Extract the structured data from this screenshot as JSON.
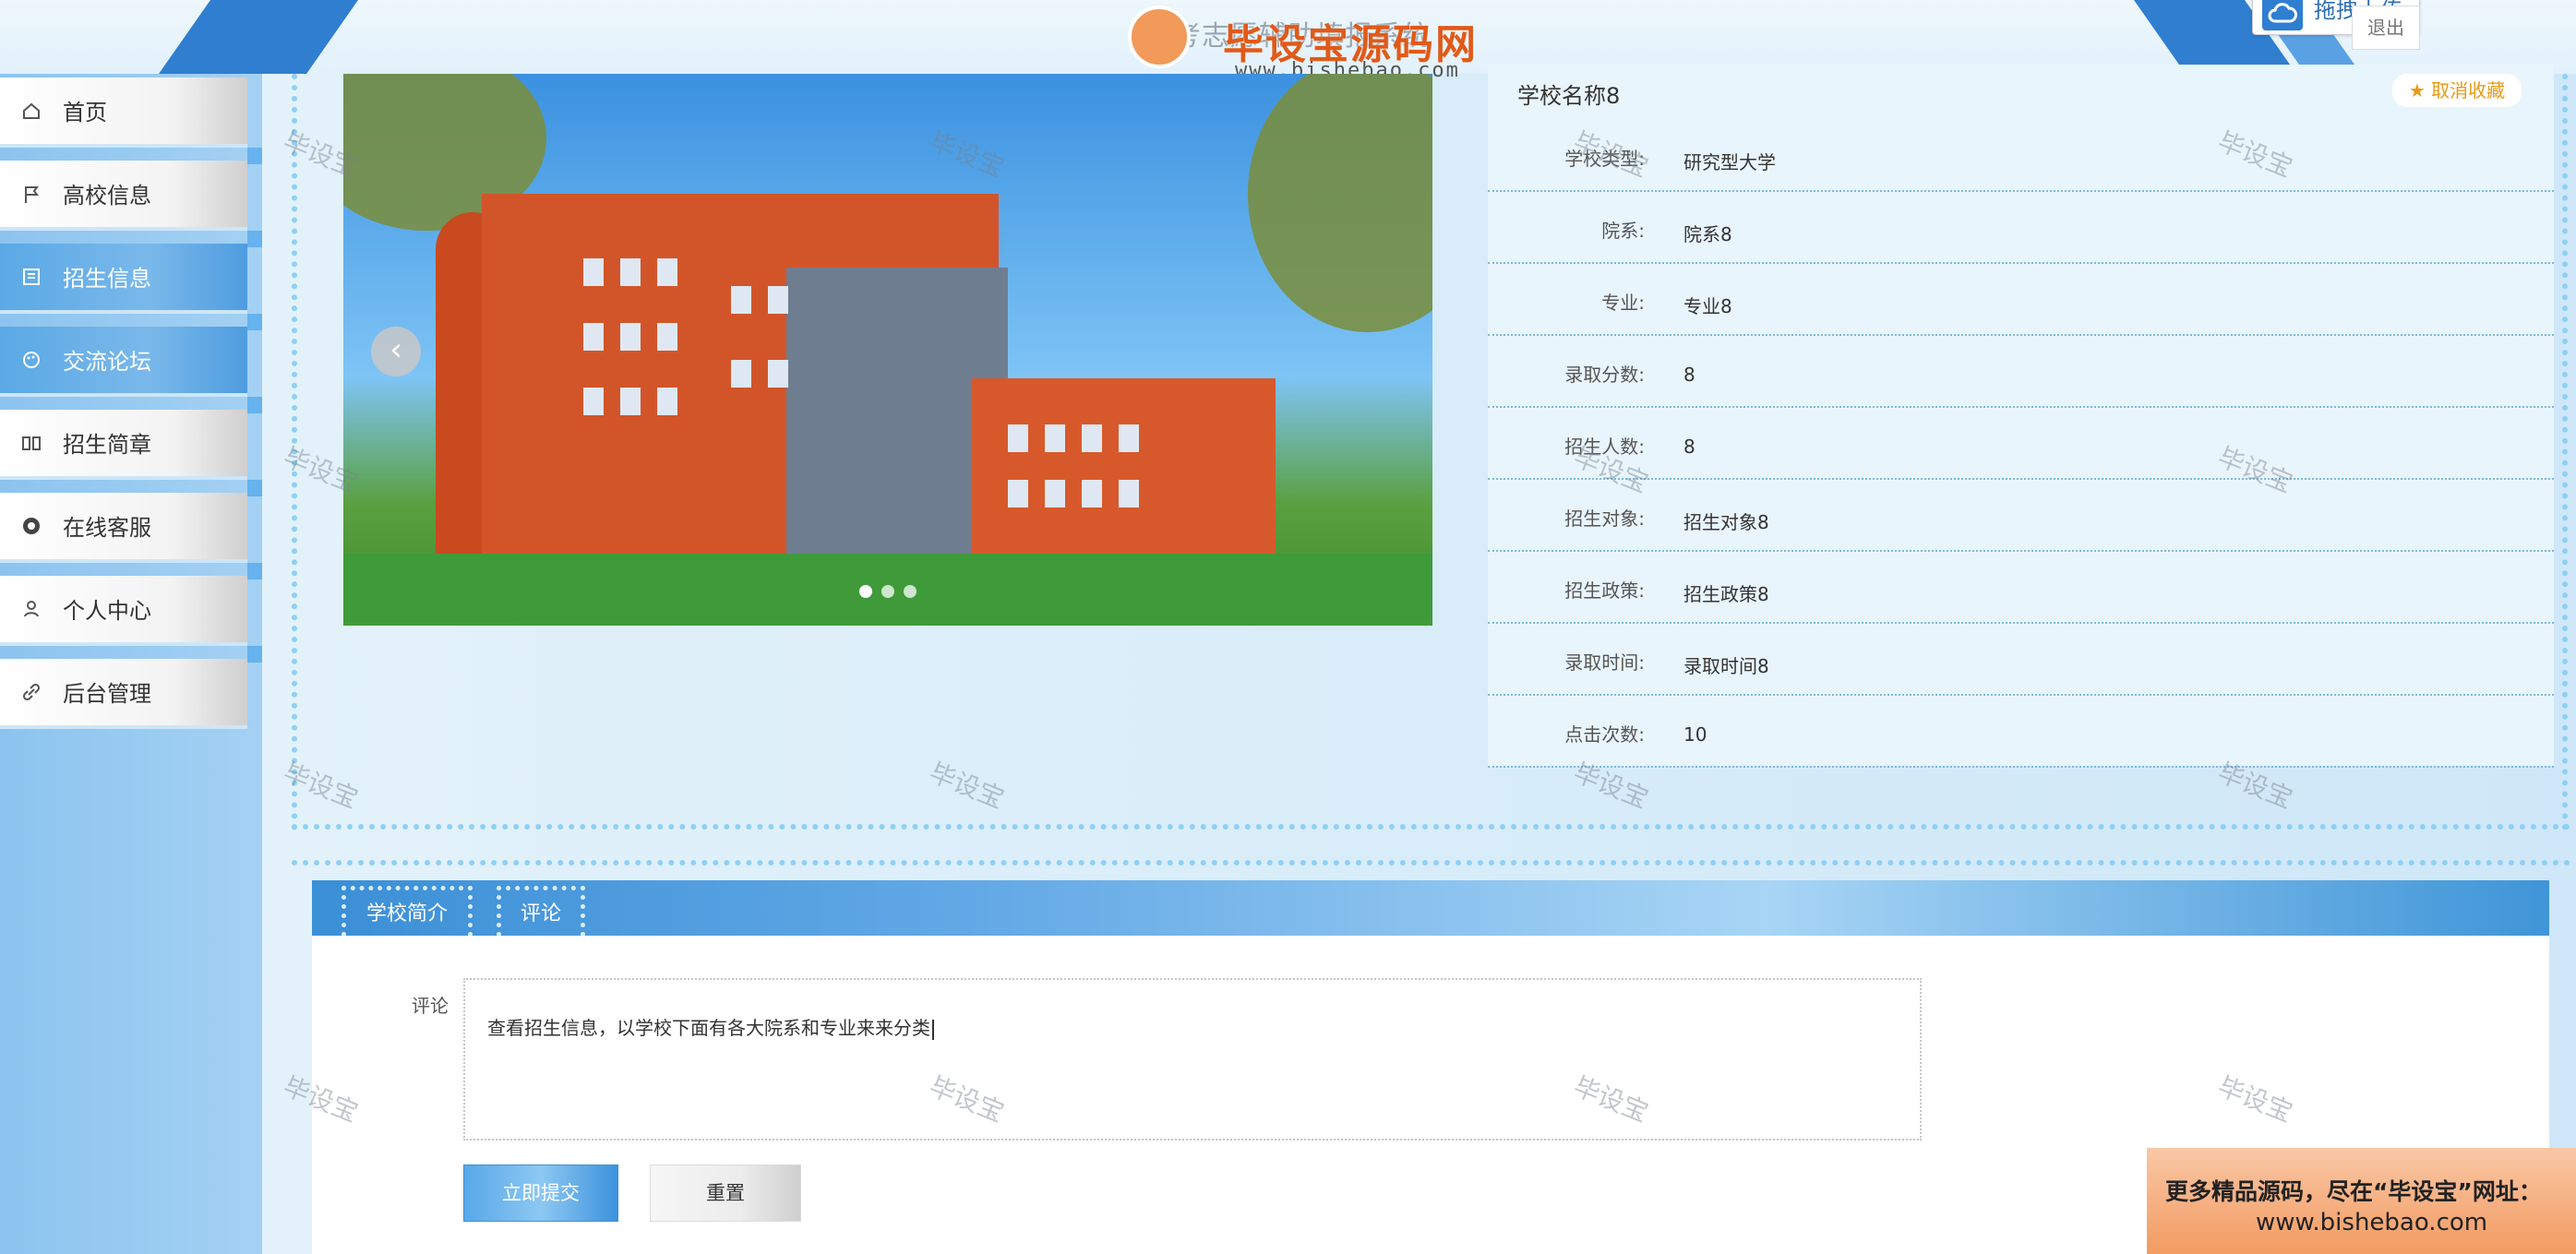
{
  "header": {
    "site_title": "高考志愿辅助填报系统",
    "upload_label": "拖拽上传",
    "logout_label": "退出"
  },
  "watermark": {
    "brand": "毕设宝源码网",
    "url": "www.bishebao.com",
    "stamp_text": "毕设宝",
    "promo_line1": "更多精品源码，尽在“毕设宝”网址：",
    "promo_line2": "www.bishebao.com"
  },
  "sidebar": {
    "items": [
      {
        "label": "首页",
        "icon": "home-icon"
      },
      {
        "label": "高校信息",
        "icon": "flag-icon"
      },
      {
        "label": "招生信息",
        "icon": "document-icon"
      },
      {
        "label": "交流论坛",
        "icon": "palette-icon"
      },
      {
        "label": "招生简章",
        "icon": "book-icon"
      },
      {
        "label": "在线客服",
        "icon": "headset-icon"
      },
      {
        "label": "个人中心",
        "icon": "user-icon"
      },
      {
        "label": "后台管理",
        "icon": "link-icon"
      }
    ],
    "active_index": 2
  },
  "carousel": {
    "slide_count": 3,
    "active_slide": 0,
    "prev_label": "‹"
  },
  "detail": {
    "title": "学校名称8",
    "favorite_label": "★ 取消收藏",
    "fields": [
      {
        "key": "学校类型:",
        "value": "研究型大学"
      },
      {
        "key": "院系:",
        "value": "院系8"
      },
      {
        "key": "专业:",
        "value": "专业8"
      },
      {
        "key": "录取分数:",
        "value": "8"
      },
      {
        "key": "招生人数:",
        "value": "8"
      },
      {
        "key": "招生对象:",
        "value": "招生对象8"
      },
      {
        "key": "招生政策:",
        "value": "招生政策8"
      },
      {
        "key": "录取时间:",
        "value": "录取时间8"
      },
      {
        "key": "点击次数:",
        "value": "10"
      }
    ]
  },
  "tabs": {
    "items": [
      {
        "label": "学校简介"
      },
      {
        "label": "评论"
      }
    ]
  },
  "comment": {
    "label": "评论",
    "value": "查看招生信息，以学校下面有各大院系和专业来来分类",
    "submit_label": "立即提交",
    "reset_label": "重置"
  },
  "colors": {
    "accent": "#2f7ed0",
    "sidebar_active": "#5aa9e6",
    "favorite": "#e79a16"
  }
}
